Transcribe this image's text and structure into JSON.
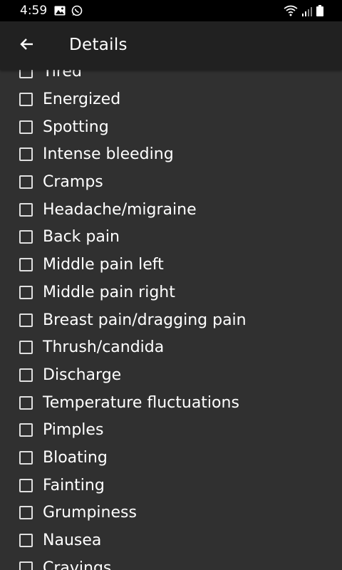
{
  "status_bar": {
    "time": "4:59",
    "left_icons": [
      "image-icon",
      "whatsapp-icon"
    ],
    "right_icons": [
      "wifi-icon",
      "signal-icon",
      "battery-icon"
    ]
  },
  "app_bar": {
    "back_icon": "arrow-back-icon",
    "title": "Details"
  },
  "colors": {
    "background": "#303030",
    "app_bar": "#212121",
    "status_bar": "#000000",
    "text": "#ffffff"
  },
  "symptoms": [
    {
      "label": "Tired",
      "checked": false
    },
    {
      "label": "Energized",
      "checked": false
    },
    {
      "label": "Spotting",
      "checked": false
    },
    {
      "label": "Intense bleeding",
      "checked": false
    },
    {
      "label": "Cramps",
      "checked": false
    },
    {
      "label": "Headache/migraine",
      "checked": false
    },
    {
      "label": "Back pain",
      "checked": false
    },
    {
      "label": "Middle pain left",
      "checked": false
    },
    {
      "label": "Middle pain right",
      "checked": false
    },
    {
      "label": "Breast pain/dragging pain",
      "checked": false
    },
    {
      "label": "Thrush/candida",
      "checked": false
    },
    {
      "label": "Discharge",
      "checked": false
    },
    {
      "label": "Temperature fluctuations",
      "checked": false
    },
    {
      "label": "Pimples",
      "checked": false
    },
    {
      "label": "Bloating",
      "checked": false
    },
    {
      "label": "Fainting",
      "checked": false
    },
    {
      "label": "Grumpiness",
      "checked": false
    },
    {
      "label": "Nausea",
      "checked": false
    },
    {
      "label": "Cravings",
      "checked": false
    }
  ]
}
